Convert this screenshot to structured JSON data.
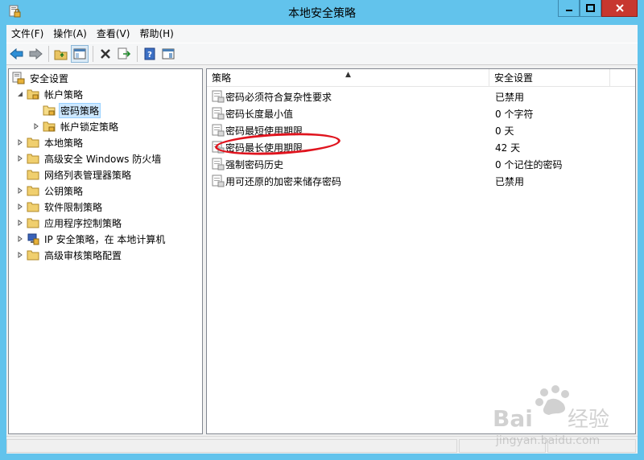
{
  "window": {
    "title": "本地安全策略"
  },
  "menu": [
    {
      "label": "文件(F)"
    },
    {
      "label": "操作(A)"
    },
    {
      "label": "查看(V)"
    },
    {
      "label": "帮助(H)"
    }
  ],
  "toolbar": {
    "icons": [
      "back-arrow-icon",
      "forward-arrow-icon",
      "up-folder-icon",
      "show-tree-icon",
      "delete-icon",
      "export-list-icon",
      "help-icon",
      "properties-icon"
    ]
  },
  "tree": {
    "root": "安全设置",
    "items": [
      {
        "label": "帐户策略"
      },
      {
        "label": "密码策略"
      },
      {
        "label": "帐户锁定策略"
      },
      {
        "label": "本地策略"
      },
      {
        "label": "高级安全 Windows 防火墙"
      },
      {
        "label": "网络列表管理器策略"
      },
      {
        "label": "公钥策略"
      },
      {
        "label": "软件限制策略"
      },
      {
        "label": "应用程序控制策略"
      },
      {
        "label": "IP 安全策略，在 本地计算机"
      },
      {
        "label": "高级审核策略配置"
      }
    ]
  },
  "list": {
    "columns": [
      {
        "label": "策略"
      },
      {
        "label": "安全设置"
      }
    ],
    "rows": [
      {
        "name": "密码必须符合复杂性要求",
        "value": "已禁用"
      },
      {
        "name": "密码长度最小值",
        "value": "0 个字符"
      },
      {
        "name": "密码最短使用期限",
        "value": "0 天"
      },
      {
        "name": "密码最长使用期限",
        "value": "42 天"
      },
      {
        "name": "强制密码历史",
        "value": "0 个记住的密码"
      },
      {
        "name": "用可还原的加密来储存密码",
        "value": "已禁用"
      }
    ]
  },
  "watermark": {
    "brand": "Baidu经验",
    "url": "jingyan.baidu.com"
  },
  "colors": {
    "titlebar": "#62c3ec",
    "close": "#c7372f",
    "selection": "#cde8ff",
    "annotation": "#e0141e"
  }
}
